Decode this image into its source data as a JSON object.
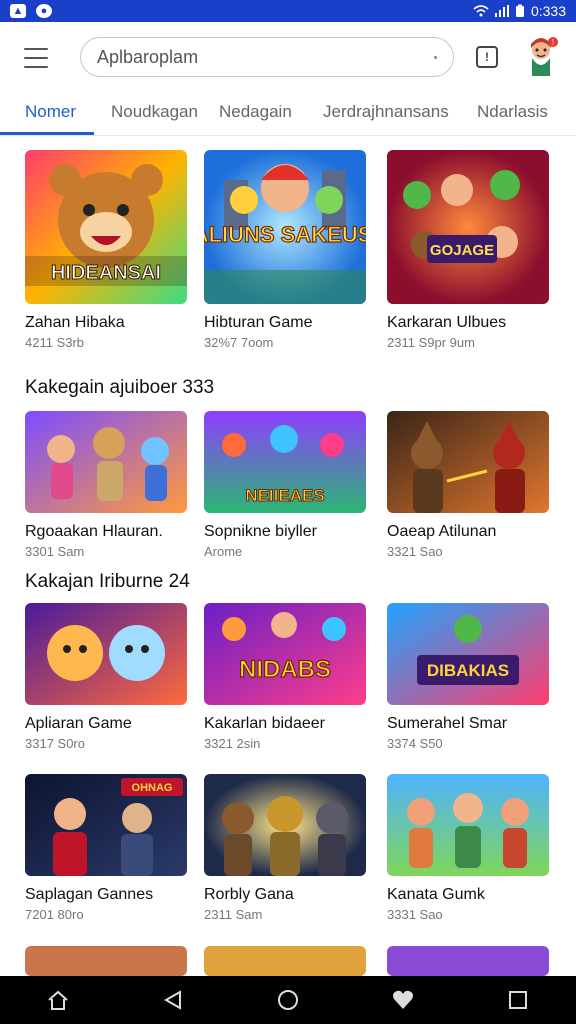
{
  "status_bar": {
    "time": "0:333",
    "left_icons": [
      "gallery-icon",
      "camera-icon"
    ],
    "right_icons": [
      "wifi-icon",
      "signal-icon",
      "battery-icon"
    ]
  },
  "header": {
    "search_text": "Aplbaroplam",
    "icons": [
      "menu-icon",
      "chat-icon",
      "avatar"
    ],
    "notification_badge": "!"
  },
  "tabs": [
    {
      "label": "Nomer",
      "active": true
    },
    {
      "label": "Noudkagan",
      "active": false
    },
    {
      "label": "Nedagain",
      "active": false
    },
    {
      "label": "Jerdrajhnansans",
      "active": false
    },
    {
      "label": "Ndarlasis",
      "active": false
    }
  ],
  "sections": [
    {
      "title": "",
      "cards": [
        {
          "title": "Zahan Hibaka",
          "meta": "4211 S3rb",
          "thumb_text": "HIDEANSAI",
          "bg": [
            "#ffb300",
            "#ff4d6d"
          ]
        },
        {
          "title": "Hibturan Game",
          "meta": "32%7 7oom",
          "thumb_text": "NALIUNS SAKEUSSI",
          "bg": [
            "#2a8cff",
            "#ffe14d"
          ]
        },
        {
          "title": "Karkaran Ulbues",
          "meta": "2311 S9pr 9um",
          "thumb_text": "GOJAGE",
          "bg": [
            "#c81e50",
            "#ff8a3d"
          ]
        }
      ]
    },
    {
      "title": "Kakegain ajuiboer 333",
      "cards": [
        {
          "title": "Rgoaakan Hlauran.",
          "meta": "3301 Sam",
          "thumb_text": "",
          "bg": [
            "#7b4dff",
            "#ffb84d"
          ]
        },
        {
          "title": "Sopnikne biyller",
          "meta": "Arome",
          "thumb_text": "NEIIEAES",
          "bg": [
            "#2bb673",
            "#8f3dff"
          ]
        },
        {
          "title": "Oaeap Atilunan",
          "meta": "3321 Sao",
          "thumb_text": "",
          "bg": [
            "#8a3b1e",
            "#e0772e"
          ]
        }
      ]
    },
    {
      "title": "Kakajan Iriburne 24",
      "cards": [
        {
          "title": "Apliaran Game",
          "meta": "3317 S0ro",
          "thumb_text": "",
          "bg": [
            "#5c1fb8",
            "#ff7a3d"
          ]
        },
        {
          "title": "Kakarlan bidaeer",
          "meta": "3321 2sin",
          "thumb_text": "NIDABS",
          "bg": [
            "#8b2fd6",
            "#ffd23d"
          ]
        },
        {
          "title": "Sumerahel Smar",
          "meta": "3374 S50",
          "thumb_text": "DIBAKIAS",
          "bg": [
            "#1fa3ff",
            "#ff3d6e"
          ]
        }
      ]
    },
    {
      "title": "",
      "cards": [
        {
          "title": "Saplagan Gannes",
          "meta": "7201 80ro",
          "thumb_text": "OHNAG",
          "bg": [
            "#111a3a",
            "#c0142b"
          ]
        },
        {
          "title": "Rorbly Gana",
          "meta": "2311 Sam",
          "thumb_text": "",
          "bg": [
            "#1e2a4a",
            "#d4a22d"
          ]
        },
        {
          "title": "Kanata Gumk",
          "meta": "3331 Sao",
          "thumb_text": "",
          "bg": [
            "#4fb3ff",
            "#7fd65a"
          ]
        }
      ]
    }
  ],
  "nav_bar": {
    "icons": [
      "home-icon",
      "back-icon",
      "circle-home-icon",
      "heart-icon",
      "recents-icon"
    ]
  }
}
